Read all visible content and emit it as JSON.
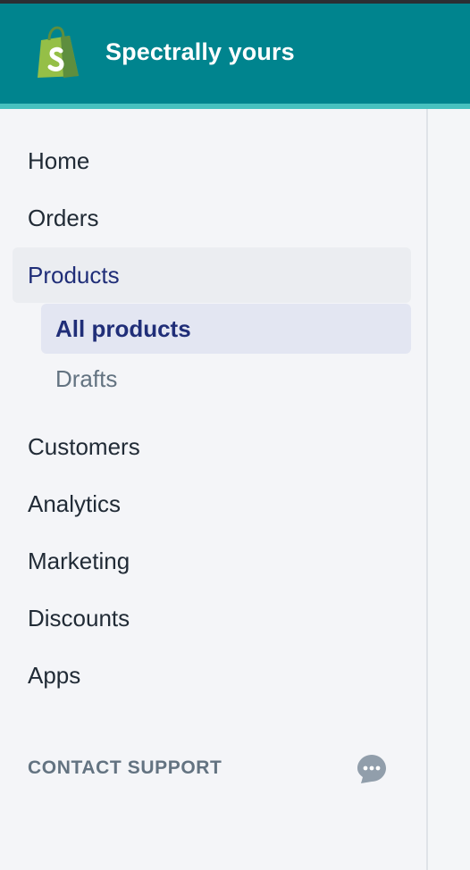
{
  "store": {
    "name": "Spectrally yours",
    "logo_icon": "shopify-bag-icon"
  },
  "nav": {
    "items": [
      {
        "id": "home",
        "label": "Home"
      },
      {
        "id": "orders",
        "label": "Orders"
      },
      {
        "id": "products",
        "label": "Products",
        "active": true
      },
      {
        "id": "customers",
        "label": "Customers"
      },
      {
        "id": "analytics",
        "label": "Analytics"
      },
      {
        "id": "marketing",
        "label": "Marketing"
      },
      {
        "id": "discounts",
        "label": "Discounts"
      },
      {
        "id": "apps",
        "label": "Apps"
      }
    ],
    "products_sub": [
      {
        "id": "all-products",
        "label": "All products",
        "selected": true
      },
      {
        "id": "drafts",
        "label": "Drafts"
      }
    ]
  },
  "support": {
    "label": "CONTACT SUPPORT",
    "icon": "chat-bubble-icon"
  },
  "colors": {
    "header": "#00848e",
    "header_accent": "#47c1bf",
    "active_text": "#202e78",
    "logo_green": "#95bf47"
  }
}
